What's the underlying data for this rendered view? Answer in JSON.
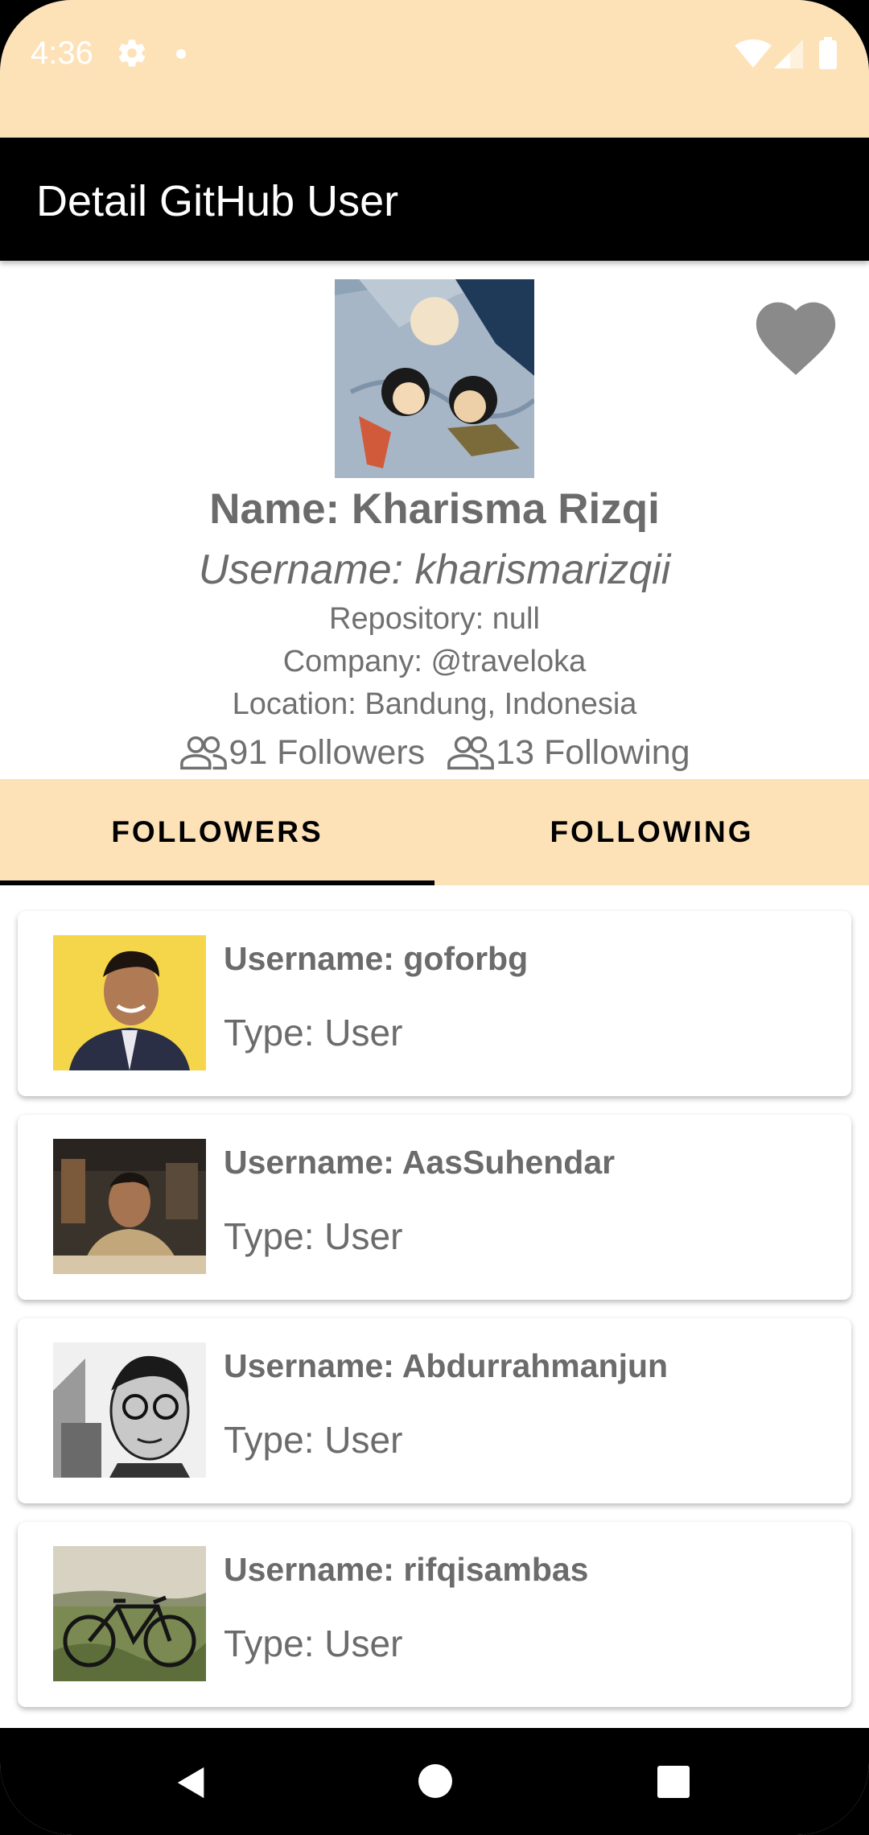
{
  "status_bar": {
    "time": "4:36"
  },
  "app_bar": {
    "title": "Detail GitHub User"
  },
  "profile": {
    "name": "Name: Kharisma Rizqi",
    "username": "Username: kharismarizqii",
    "repository": "Repository: null",
    "company": "Company: @traveloka",
    "location": "Location: Bandung, Indonesia",
    "followers": "91 Followers",
    "following": "13 Following"
  },
  "tabs": [
    {
      "label": "FOLLOWERS",
      "selected": true
    },
    {
      "label": "FOLLOWING",
      "selected": false
    }
  ],
  "list": [
    {
      "username": "Username: goforbg",
      "type": "Type: User"
    },
    {
      "username": "Username: AasSuhendar",
      "type": "Type: User"
    },
    {
      "username": "Username: Abdurrahmanjun",
      "type": "Type: User"
    },
    {
      "username": "Username: rifqisambas",
      "type": "Type: User"
    }
  ],
  "icons": {
    "favorite": "heart-icon",
    "followers": "people-icon",
    "following": "people-icon"
  },
  "colors": {
    "status_bar_bg": "#fde2b8",
    "app_bar_bg": "#000000",
    "tab_bar_bg": "#fde2b8",
    "favorite_icon": "#8a8a8a",
    "text_grey": "#6b6b6b"
  }
}
